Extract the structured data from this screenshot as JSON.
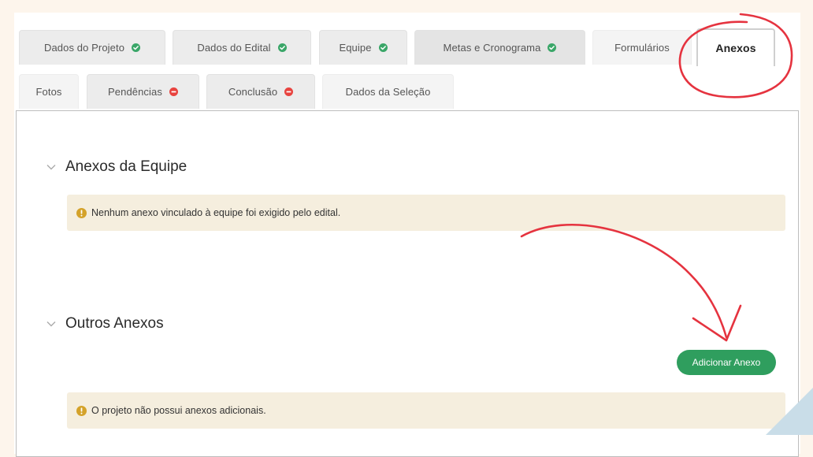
{
  "tabs_row1": [
    {
      "label": "Dados do Projeto",
      "status": "ok"
    },
    {
      "label": "Dados do Edital",
      "status": "ok"
    },
    {
      "label": "Equipe",
      "status": "ok"
    },
    {
      "label": "Metas e Cronograma",
      "status": "ok"
    },
    {
      "label": "Formulários",
      "status": "none"
    },
    {
      "label": "Anexos",
      "status": "active"
    }
  ],
  "tabs_row2": [
    {
      "label": "Fotos",
      "status": "none"
    },
    {
      "label": "Pendências",
      "status": "error"
    },
    {
      "label": "Conclusão",
      "status": "error"
    },
    {
      "label": "Dados da Seleção",
      "status": "none"
    }
  ],
  "sections": {
    "team": {
      "title": "Anexos da Equipe",
      "alert": "Nenhum anexo vinculado à equipe foi exigido pelo edital."
    },
    "others": {
      "title": "Outros Anexos",
      "add_button": "Adicionar Anexo",
      "alert": "O projeto não possui anexos adicionais."
    }
  },
  "colors": {
    "ok": "#3aa668",
    "error": "#e8433f",
    "info": "#d4a22a",
    "primary_button": "#2f9e5e",
    "annotation": "#e5333f",
    "alert_bg": "#f5eede",
    "page_bg": "#fdf5ec"
  },
  "icons": {
    "ok": "check-circle-icon",
    "error": "minus-circle-icon",
    "info": "info-circle-icon",
    "collapse": "chevron-down-icon"
  }
}
